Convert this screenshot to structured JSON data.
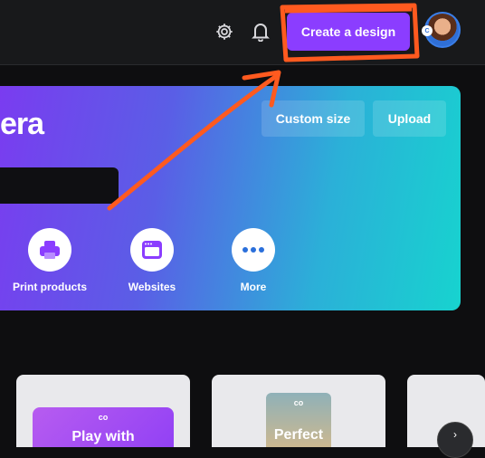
{
  "topbar": {
    "settings_icon": "gear-icon",
    "notifications_icon": "bell-icon",
    "create_label": "Create a design",
    "account_icon": "avatar",
    "badge_text": "C"
  },
  "hero": {
    "title_partial": "era",
    "custom_size_label": "Custom size",
    "upload_label": "Upload",
    "categories": [
      {
        "label": "Print products",
        "icon": "printer-icon"
      },
      {
        "label": "Websites",
        "icon": "website-icon"
      },
      {
        "label": "More",
        "icon": "more-icon"
      }
    ]
  },
  "cards": [
    {
      "logo_text": "co",
      "caption_partial": "Play with"
    },
    {
      "logo_text": "co",
      "caption_partial": "Perfect"
    }
  ],
  "annotation": {
    "color": "#ff5a1f"
  },
  "colors": {
    "brand": "#8b3dff",
    "topbar": "#18191b"
  }
}
